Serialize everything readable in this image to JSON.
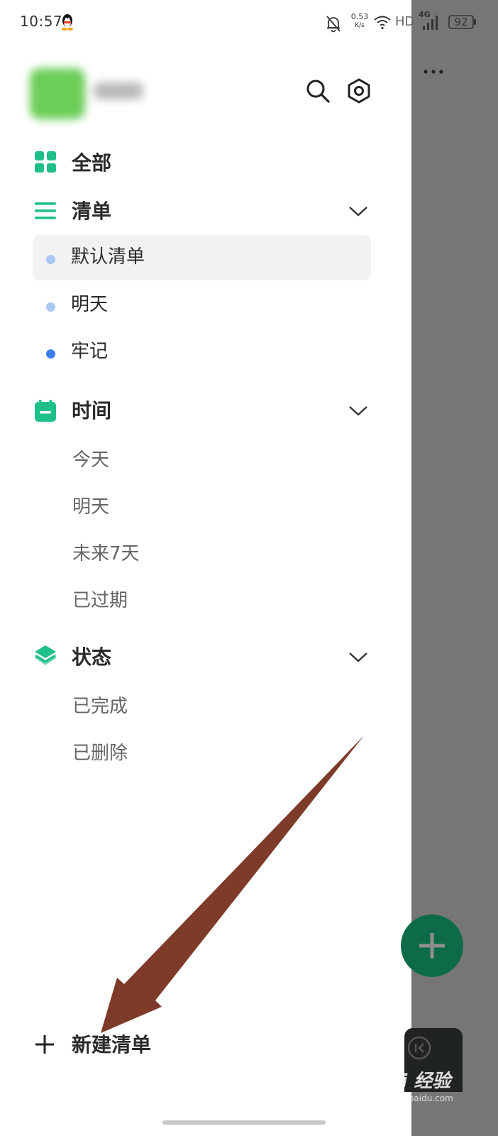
{
  "status_bar": {
    "time": "10:57",
    "net_speed_value": "0.53",
    "net_speed_unit": "K/s",
    "hd": "HD",
    "network": "4G",
    "battery": "92"
  },
  "header": {
    "search_icon": "search-icon",
    "settings_icon": "settings-icon",
    "more_icon": "more-icon"
  },
  "nav": {
    "all": {
      "label": "全部",
      "icon": "grid-icon"
    },
    "lists": {
      "label": "清单",
      "icon": "list-icon",
      "items": [
        {
          "label": "默认清单",
          "color": "#a9c8f5",
          "selected": true
        },
        {
          "label": "明天",
          "color": "#a9c8f5",
          "selected": false
        },
        {
          "label": "牢记",
          "color": "#3d7ff0",
          "selected": false
        }
      ]
    },
    "time": {
      "label": "时间",
      "icon": "calendar-icon",
      "items": [
        "今天",
        "明天",
        "未来7天",
        "已过期"
      ]
    },
    "status": {
      "label": "状态",
      "icon": "layers-icon",
      "items": [
        "已完成",
        "已删除"
      ]
    }
  },
  "footer": {
    "new_list_label": "新建清单"
  },
  "watermark": {
    "text": "Bai 经验",
    "sub": "jingyan.baidu.com"
  },
  "colors": {
    "accent": "#1fbf8a",
    "backdrop": "#767676",
    "fab": "#0d6b47",
    "arrow": "#7e3b29"
  }
}
